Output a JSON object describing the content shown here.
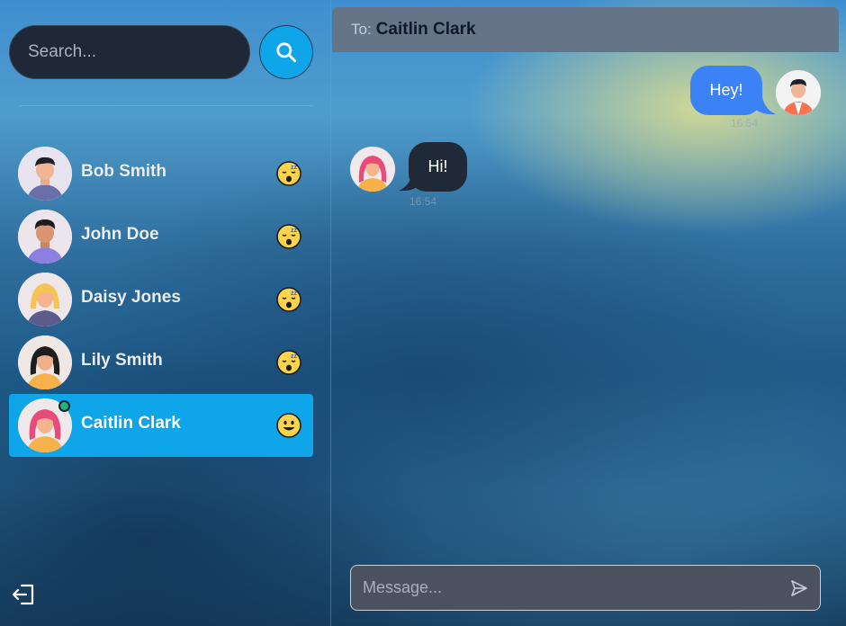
{
  "search": {
    "placeholder": "Search..."
  },
  "contacts": [
    {
      "name": "Bob Smith",
      "status_icon": "sleeping-emoji",
      "online": false,
      "active": false
    },
    {
      "name": "John Doe",
      "status_icon": "sleeping-emoji",
      "online": false,
      "active": false
    },
    {
      "name": "Daisy Jones",
      "status_icon": "sleeping-emoji",
      "online": false,
      "active": false
    },
    {
      "name": "Lily Smith",
      "status_icon": "sleeping-emoji",
      "online": false,
      "active": false
    },
    {
      "name": "Caitlin Clark",
      "status_icon": "smiling-emoji",
      "online": true,
      "active": true
    }
  ],
  "chat": {
    "to_label": "To:",
    "to_name": "Caitlin Clark",
    "messages": [
      {
        "direction": "outgoing",
        "text": "Hey!",
        "time": "16:54"
      },
      {
        "direction": "incoming",
        "text": "Hi!",
        "time": "16:54"
      }
    ],
    "composer_placeholder": "Message..."
  },
  "colors": {
    "accent": "#0ea5e9",
    "outgoing_bubble": "#3b82f6",
    "incoming_bubble": "#1f2937",
    "online_dot": "#1fb57a",
    "header_bg": "#667487"
  },
  "icons": {
    "search": "search-icon",
    "logout": "logout-icon",
    "send": "send-icon"
  }
}
